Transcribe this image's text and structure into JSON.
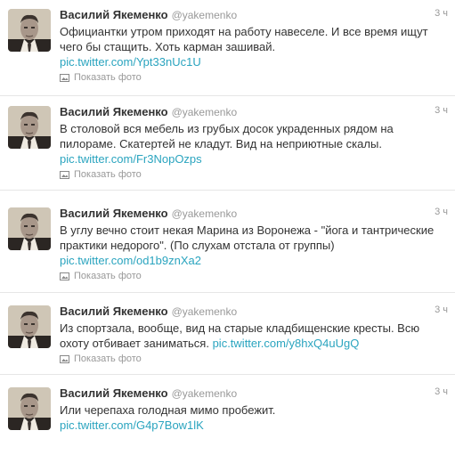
{
  "author": {
    "name": "Василий Якеменко",
    "handle": "@yakemenko"
  },
  "media_label": "Показать фото",
  "icons": {
    "avatar": "portrait-photo",
    "media": "photo-icon"
  },
  "colors": {
    "link": "#2aa4bf",
    "meta": "#999999",
    "text": "#333333"
  },
  "tweets": [
    {
      "time": "3 ч",
      "text": "Официантки утром приходят на работу навеселе. И все время ищут чего бы стащить. Хоть карман зашивай.",
      "link": "pic.twitter.com/Ypt33nUc1U",
      "has_media": true
    },
    {
      "time": "3 ч",
      "text": "В столовой вся мебель из грубых досок украденных рядом на пилораме. Скатертей не кладут. Вид на неприютные скалы.",
      "link": "pic.twitter.com/Fr3NopOzps",
      "has_media": true
    },
    {
      "time": "3 ч",
      "text": "В углу вечно стоит некая Марина из Воронежа - \"йога и тантрические практики недорого\". (По слухам отстала от группы)",
      "link": "pic.twitter.com/od1b9znXa2",
      "has_media": true
    },
    {
      "time": "3 ч",
      "text": "Из спортзала, вообще, вид на старые кладбищенские кресты. Всю охоту отбивает заниматься.",
      "link": "pic.twitter.com/y8hxQ4uUgQ",
      "has_media": true
    },
    {
      "time": "3 ч",
      "text": "Или черепаха голодная  мимо пробежит.",
      "link": "pic.twitter.com/G4p7Bow1lK",
      "has_media": false
    }
  ]
}
